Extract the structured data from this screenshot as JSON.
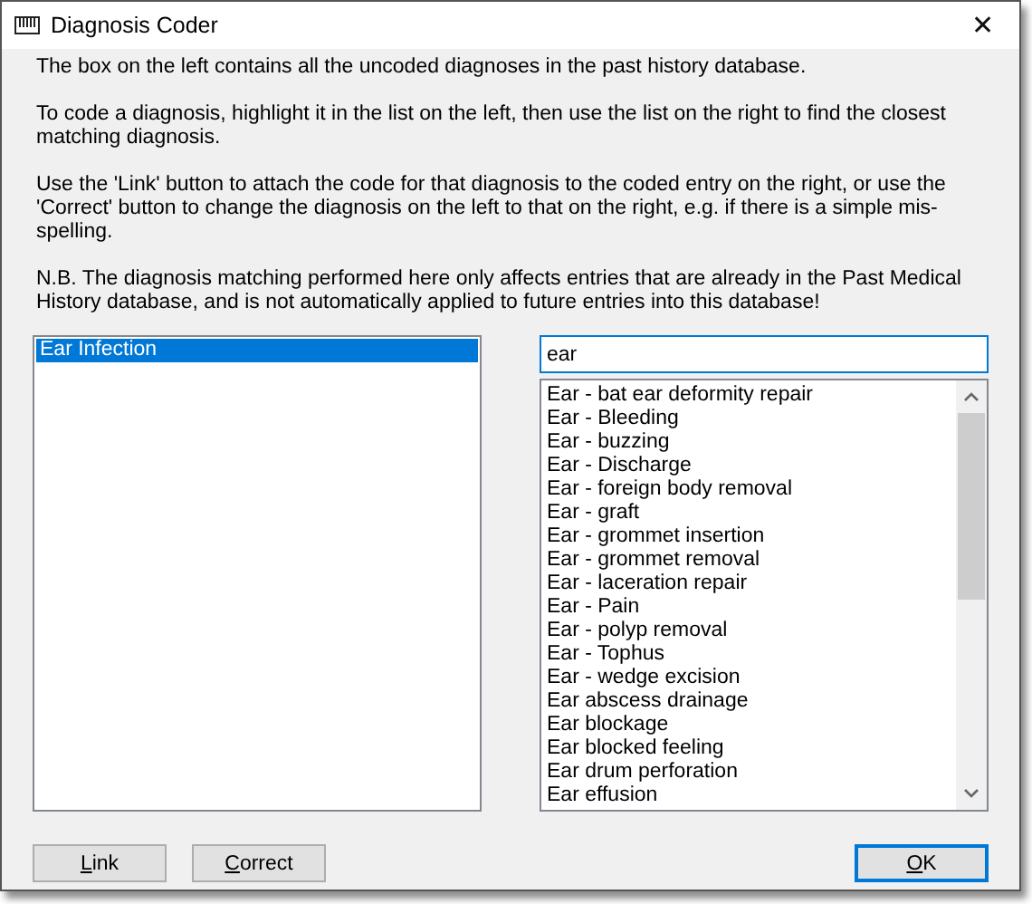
{
  "window": {
    "title": "Diagnosis Coder",
    "close": "✕"
  },
  "instructions": [
    "The box on the left contains all the uncoded diagnoses in the past history database.",
    "To code a diagnosis, highlight it in the list on the left, then use the list on the right to find the closest matching diagnosis.",
    "Use the 'Link' button to attach the code for that diagnosis to the coded entry on the right, or use the 'Correct' button to change the diagnosis on the left to that on the right, e.g. if there is a simple mis-spelling.",
    "N.B. The diagnosis matching performed here only affects entries that are already in the Past Medical History database, and is not automatically applied to future entries into this database!"
  ],
  "uncoded_list": [
    {
      "label": "Ear Infection",
      "selected": true
    }
  ],
  "search": {
    "value": "ear"
  },
  "matches": [
    {
      "label": "Ear - bat ear deformity repair",
      "selected": false
    },
    {
      "label": "Ear - Bleeding",
      "selected": false
    },
    {
      "label": "Ear - buzzing",
      "selected": false
    },
    {
      "label": "Ear - Discharge",
      "selected": false
    },
    {
      "label": "Ear - foreign body removal",
      "selected": false
    },
    {
      "label": "Ear - graft",
      "selected": false
    },
    {
      "label": "Ear - grommet insertion",
      "selected": false
    },
    {
      "label": "Ear - grommet removal",
      "selected": false
    },
    {
      "label": "Ear - laceration repair",
      "selected": false
    },
    {
      "label": "Ear - Pain",
      "selected": false
    },
    {
      "label": "Ear - polyp removal",
      "selected": false
    },
    {
      "label": "Ear - Tophus",
      "selected": false
    },
    {
      "label": "Ear - wedge excision",
      "selected": false
    },
    {
      "label": "Ear abscess drainage",
      "selected": false
    },
    {
      "label": "Ear blockage",
      "selected": false
    },
    {
      "label": "Ear blocked feeling",
      "selected": false
    },
    {
      "label": "Ear drum perforation",
      "selected": false
    },
    {
      "label": "Ear effusion",
      "selected": false
    }
  ],
  "buttons": [
    {
      "label": "Link",
      "mnemonic": true,
      "default": false
    },
    {
      "label": "Correct",
      "mnemonic": true,
      "default": false
    },
    {
      "label": "OK",
      "mnemonic": true,
      "default": true
    }
  ]
}
